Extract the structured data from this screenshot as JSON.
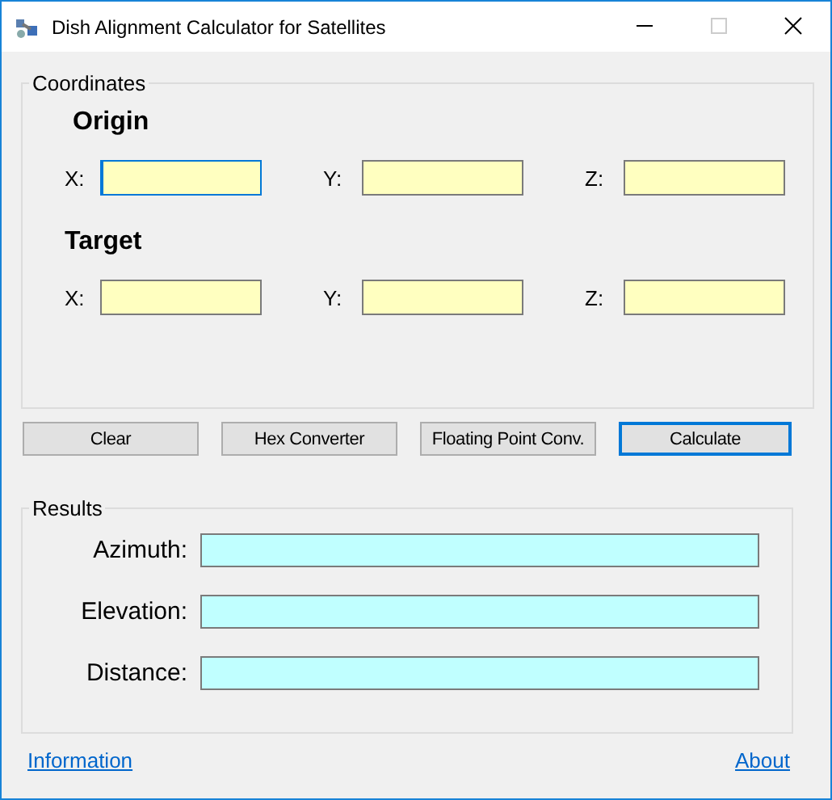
{
  "window": {
    "title": "Dish Alignment Calculator for Satellites"
  },
  "coordinates": {
    "title": "Coordinates",
    "sections": [
      {
        "heading": "Origin",
        "fields": [
          {
            "label": "X:",
            "focused": true
          },
          {
            "label": "Y:",
            "focused": false
          },
          {
            "label": "Z:",
            "focused": false
          }
        ]
      },
      {
        "heading": "Target",
        "fields": [
          {
            "label": "X:",
            "focused": false
          },
          {
            "label": "Y:",
            "focused": false
          },
          {
            "label": "Z:",
            "focused": false
          }
        ]
      }
    ]
  },
  "buttons": [
    {
      "label": "Clear",
      "focused": false
    },
    {
      "label": "Hex Converter",
      "focused": false
    },
    {
      "label": "Floating Point Conv.",
      "focused": false
    },
    {
      "label": "Calculate",
      "focused": true
    }
  ],
  "results": {
    "title": "Results",
    "fields": [
      {
        "label": "Azimuth:"
      },
      {
        "label": "Elevation:"
      },
      {
        "label": "Distance:"
      }
    ]
  },
  "links": [
    "Information",
    "About"
  ]
}
